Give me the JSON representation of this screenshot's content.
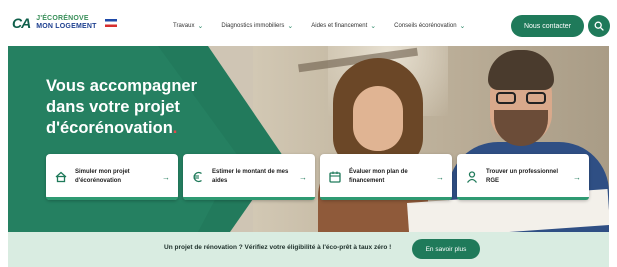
{
  "header": {
    "logo_mark": "CA",
    "logo_line1": "J'ÉCORÉNOVE",
    "logo_line2": "MON LOGEMENT",
    "nav": [
      {
        "label": "Travaux"
      },
      {
        "label": "Diagnostics immobiliers"
      },
      {
        "label": "Aides et financement"
      },
      {
        "label": "Conseils écorénovation"
      }
    ],
    "contact_label": "Nous contacter",
    "search_icon": "search-icon"
  },
  "hero": {
    "title_lines": [
      "Vous accompagner",
      "dans votre projet",
      "d'écorénovation"
    ],
    "title_dot": ".",
    "colors": {
      "primary_green": "#227a5c",
      "accent_red": "#e24a4a"
    }
  },
  "cards": [
    {
      "label": "Simuler mon projet d'écorénovation",
      "icon": "house-icon",
      "arrow": "→"
    },
    {
      "label": "Estimer le montant de mes aides",
      "icon": "euro-icon",
      "arrow": "→"
    },
    {
      "label": "Évaluer mon plan de financement",
      "icon": "calendar-icon",
      "arrow": "→"
    },
    {
      "label": "Trouver un professionnel RGE",
      "icon": "person-icon",
      "arrow": "→"
    }
  ],
  "banner": {
    "text": "Un projet de rénovation ? Vérifiez votre éligibilité à l'éco-prêt à taux zéro !",
    "button_label": "En savoir plus"
  }
}
